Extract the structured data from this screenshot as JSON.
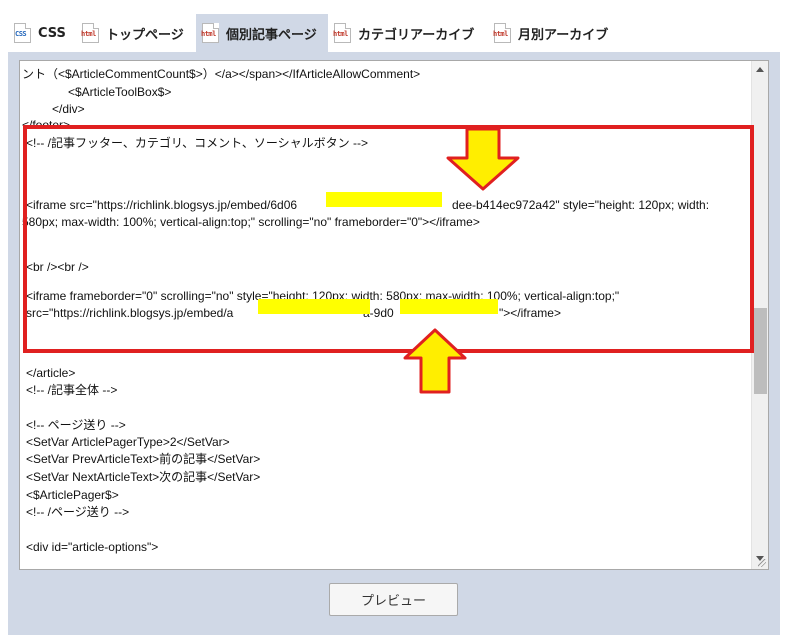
{
  "tabs": [
    {
      "icon": "css-file-icon",
      "icon_text": "CSS",
      "label": "CSS",
      "active": false
    },
    {
      "icon": "html-file-icon",
      "icon_text": "html",
      "label": "トップページ",
      "active": false
    },
    {
      "icon": "html-file-icon",
      "icon_text": "html",
      "label": "個別記事ページ",
      "active": true
    },
    {
      "icon": "html-file-icon",
      "icon_text": "html",
      "label": "カテゴリアーカイブ",
      "active": false
    },
    {
      "icon": "html-file-icon",
      "icon_text": "html",
      "label": "月別アーカイブ",
      "active": false
    }
  ],
  "editor": {
    "lines": [
      "ント（<$ArticleCommentCount$>）</a></span></IfArticleAllowComment>",
      "<$ArticleToolBox$>",
      "</div>",
      "</footer>",
      "<!-- /記事フッター、カテゴリ、コメント、ソーシャルボタン -->",
      "<iframe  src=\"https://richlink.blogsys.jp/embed/6d06",
      "dee-b414ec972a42\" style=\"height: 120px; width:",
      "580px; max-width: 100%; vertical-align:top;\" scrolling=\"no\" frameborder=\"0\"></iframe>",
      "<br /><br />",
      "<iframe  frameborder=\"0\" scrolling=\"no\" style=\"height: 120px; width: 580px; max-width: 100%; vertical-align:top;\"",
      "src=\"https://richlink.blogsys.jp/embed/a",
      "a-9d0",
      "\"></iframe>",
      "</article>",
      "<!-- /記事全体 -->",
      "<!-- ページ送り -->",
      "<SetVar ArticlePagerType>2</SetVar>",
      "<SetVar PrevArticleText>前の記事</SetVar>",
      "<SetVar NextArticleText>次の記事</SetVar>",
      "<$ArticlePager$>",
      "<!-- /ページ送り -->",
      "<div id=\"article-options\">"
    ]
  },
  "annotation": {
    "box_color": "#e02020",
    "highlight_color": "#ffff00",
    "arrow_color": "#ffee00"
  },
  "buttons": {
    "preview": "プレビュー"
  }
}
